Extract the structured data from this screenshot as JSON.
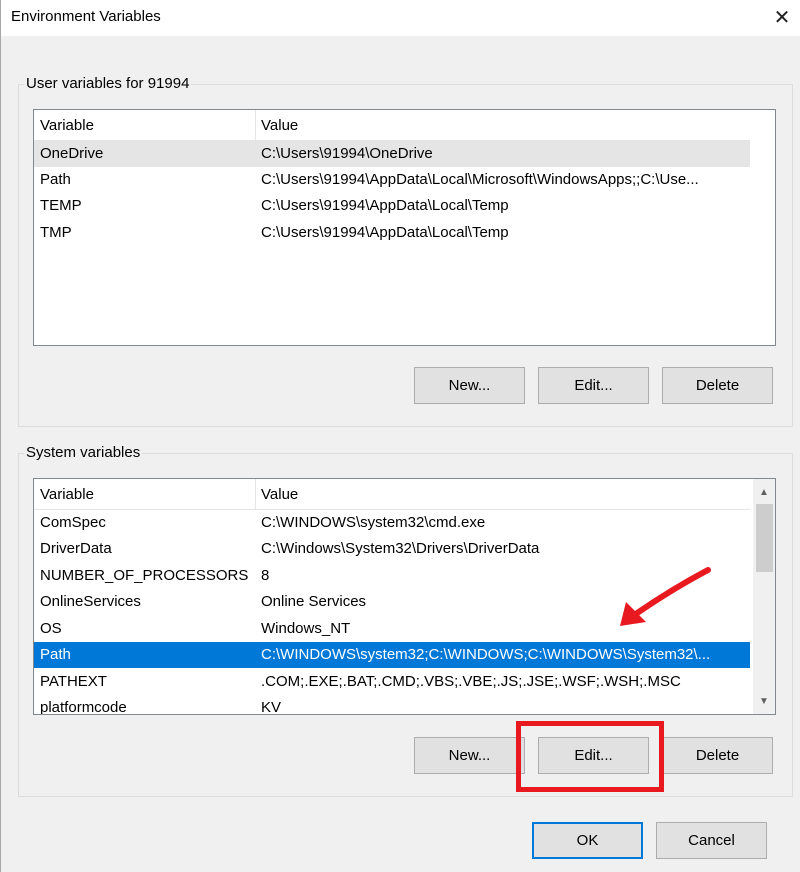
{
  "window": {
    "title": "Environment Variables"
  },
  "user_vars": {
    "label": "User variables for 91994",
    "columns": [
      "Variable",
      "Value"
    ],
    "rows": [
      {
        "name": "OneDrive",
        "value": "C:\\Users\\91994\\OneDrive"
      },
      {
        "name": "Path",
        "value": "C:\\Users\\91994\\AppData\\Local\\Microsoft\\WindowsApps;;C:\\Use..."
      },
      {
        "name": "TEMP",
        "value": "C:\\Users\\91994\\AppData\\Local\\Temp"
      },
      {
        "name": "TMP",
        "value": "C:\\Users\\91994\\AppData\\Local\\Temp"
      }
    ],
    "buttons": {
      "new": "New...",
      "edit": "Edit...",
      "delete": "Delete"
    }
  },
  "system_vars": {
    "label": "System variables",
    "columns": [
      "Variable",
      "Value"
    ],
    "rows": [
      {
        "name": "ComSpec",
        "value": "C:\\WINDOWS\\system32\\cmd.exe"
      },
      {
        "name": "DriverData",
        "value": "C:\\Windows\\System32\\Drivers\\DriverData"
      },
      {
        "name": "NUMBER_OF_PROCESSORS",
        "value": "8"
      },
      {
        "name": "OnlineServices",
        "value": "Online Services"
      },
      {
        "name": "OS",
        "value": "Windows_NT"
      },
      {
        "name": "Path",
        "value": "C:\\WINDOWS\\system32;C:\\WINDOWS;C:\\WINDOWS\\System32\\..."
      },
      {
        "name": "PATHEXT",
        "value": ".COM;.EXE;.BAT;.CMD;.VBS;.VBE;.JS;.JSE;.WSF;.WSH;.MSC"
      },
      {
        "name": "platformcode",
        "value": "KV"
      }
    ],
    "selected_row": "Path",
    "buttons": {
      "new": "New...",
      "edit": "Edit...",
      "delete": "Delete"
    }
  },
  "footer": {
    "ok": "OK",
    "cancel": "Cancel"
  },
  "colors": {
    "selection": "#0078d7",
    "annotation": "#e8191f"
  },
  "icons": {
    "close": "close-icon",
    "scroll_up": "chevron-up-icon",
    "scroll_down": "chevron-down-icon"
  }
}
